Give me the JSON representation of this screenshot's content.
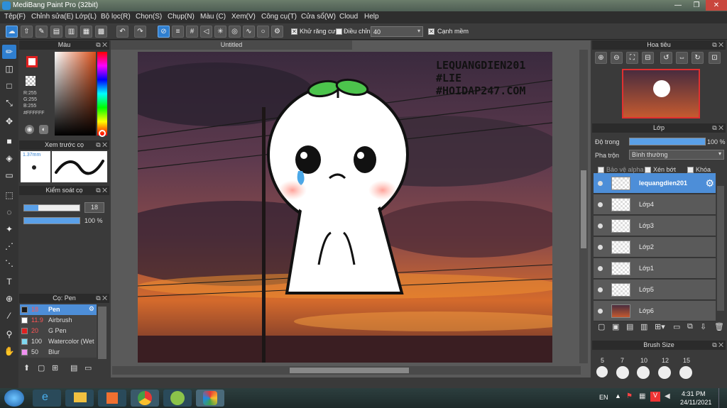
{
  "window": {
    "title": "MediBang Paint Pro (32bit)"
  },
  "menu": [
    "Tệp(F)",
    "Chỉnh sửa(E)",
    "Lớp(L)",
    "Bộ lọc(R)",
    "Chọn(S)",
    "Chụp(N)",
    "Màu (C)",
    "Xem(V)",
    "Công cụ(T)",
    "Cửa sổ(W)",
    "Cloud",
    "Help"
  ],
  "toolbar": {
    "antialias_label": "Khử răng cưa",
    "correction_label": "Điều chỉnh",
    "correction_value": "40",
    "edge_label": "Cạnh mềm"
  },
  "color_panel": {
    "title": "Màu",
    "r": "R:255",
    "g": "G:255",
    "b": "B:255",
    "hex": "#FFFFFF",
    "primary": "#e02020",
    "secondary": "#ffffff"
  },
  "brush_preview": {
    "title": "Xem trước cọ",
    "size": "1.37mm"
  },
  "brush_control": {
    "title": "Kiểm soát cọ",
    "size": "18",
    "opacity": "100 %",
    "size_fraction": 0.25,
    "opacity_fraction": 1.0
  },
  "brush_list": {
    "title": "Cọ: Pen",
    "items": [
      {
        "color": "#1a1a1a",
        "size": "18",
        "name": "Pen"
      },
      {
        "color": "#ffffff",
        "size": "11.9",
        "name": "Airbrush"
      },
      {
        "color": "#e02020",
        "size": "20",
        "name": "G Pen"
      },
      {
        "color": "#7fd8f0",
        "size": "100",
        "name": "Watercolor (Wet"
      },
      {
        "color": "#f090f0",
        "size": "50",
        "name": "Blur"
      }
    ]
  },
  "canvas": {
    "tab": "Untitled",
    "watermark": [
      "LEQUANGDIEN201",
      "#LIE",
      "#HOIDAP247.COM"
    ]
  },
  "navigator": {
    "title": "Hoa tiêu"
  },
  "layer_panel": {
    "title": "Lớp",
    "opacity_label": "Độ trong",
    "opacity_value": "100 %",
    "opacity_fraction": 1.0,
    "blend_label": "Pha trộn",
    "blend_value": "Bình thường",
    "protect_alpha": "Bảo vệ alpha",
    "clipping": "Xén bớt",
    "lock": "Khóa",
    "layers": [
      {
        "name": "lequangdien201",
        "selected": true
      },
      {
        "name": "Lớp4",
        "selected": false
      },
      {
        "name": "Lớp3",
        "selected": false
      },
      {
        "name": "Lớp2",
        "selected": false
      },
      {
        "name": "Lớp1",
        "selected": false
      },
      {
        "name": "Lớp5",
        "selected": false
      },
      {
        "name": "Lớp6",
        "selected": false
      }
    ]
  },
  "brush_size": {
    "title": "Brush Size",
    "sizes": [
      "5",
      "7",
      "10",
      "12",
      "15"
    ]
  },
  "taskbar": {
    "lang": "EN",
    "time": "4:31 PM",
    "date": "24/11/2021"
  }
}
